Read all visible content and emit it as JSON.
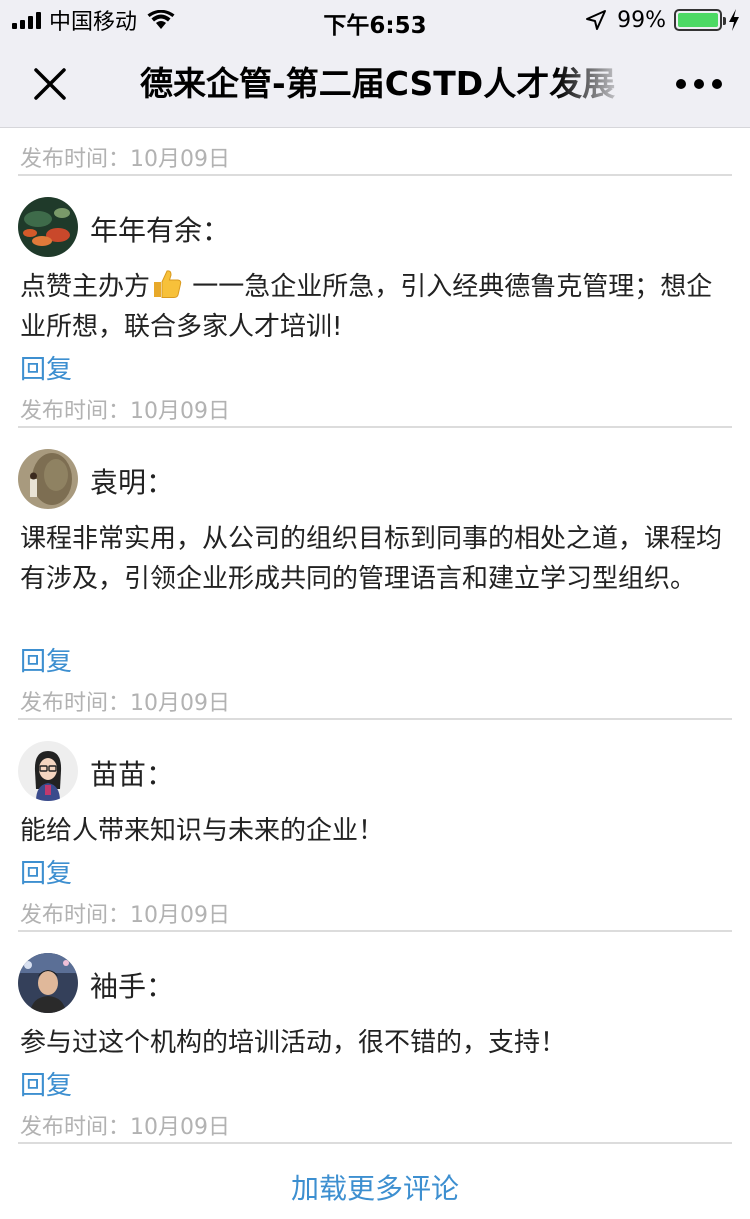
{
  "status_bar": {
    "carrier": "中国移动",
    "time": "下午6:53",
    "battery_percent": "99%",
    "battery_level": 0.99
  },
  "nav": {
    "title": "德来企管-第二届CSTD人才发展"
  },
  "top_time": "发布时间：10月09日",
  "comments": [
    {
      "name": "年年有余：",
      "text_before_emoji": "点赞主办方",
      "emoji": "thumbs-up-icon",
      "text_after_emoji": " 一一急企业所急，引入经典德鲁克管理；想企业所想，联合多家人才培训!",
      "reply": "回复",
      "time": "发布时间：10月09日"
    },
    {
      "name": "袁明：",
      "text": "课程非常实用，从公司的组织目标到同事的相处之道，课程均有涉及，引领企业形成共同的管理语言和建立学习型组织。",
      "reply": "回复",
      "time": "发布时间：10月09日"
    },
    {
      "name": "苗苗：",
      "text": "能给人带来知识与未来的企业！",
      "reply": "回复",
      "time": "发布时间：10月09日"
    },
    {
      "name": "袖手：",
      "text": "参与过这个机构的培训活动，很不错的，支持！",
      "reply": "回复",
      "time": "发布时间：10月09日"
    }
  ],
  "load_more": "加载更多评论"
}
